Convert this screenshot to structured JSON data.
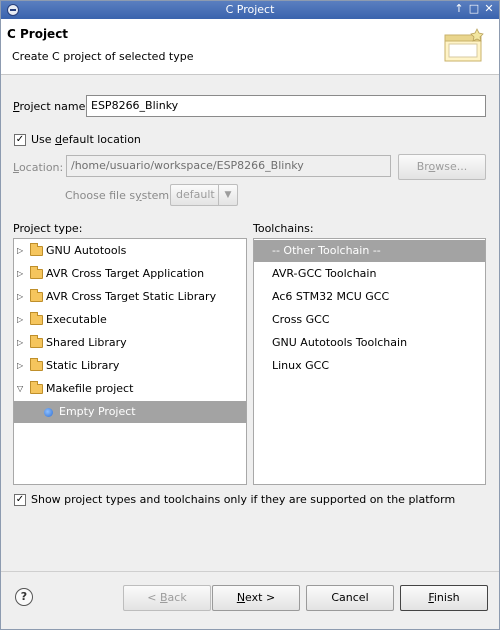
{
  "window": {
    "title": "C Project"
  },
  "header": {
    "title": "C Project",
    "subtitle": "Create C project of selected type"
  },
  "project_name": {
    "label_pre": "P",
    "label_rest": "roject name:",
    "value": "ESP8266_Blinky"
  },
  "use_default": {
    "label_pre": "Use ",
    "label_u": "d",
    "label_rest": "efault location",
    "checked_glyph": "✓"
  },
  "location": {
    "label_u": "L",
    "label_rest": "ocation:",
    "value": "/home/usuario/workspace/ESP8266_Blinky",
    "browse_pre": "Br",
    "browse_u": "o",
    "browse_rest": "wse..."
  },
  "file_system": {
    "label_pre": "Choose file s",
    "label_u": "y",
    "label_rest": "stem:",
    "value": "default"
  },
  "project_type": {
    "label": "Project type:",
    "items": [
      {
        "label": "GNU Autotools",
        "expanded": false
      },
      {
        "label": "AVR Cross Target Application",
        "expanded": false
      },
      {
        "label": "AVR Cross Target Static Library",
        "expanded": false
      },
      {
        "label": "Executable",
        "expanded": false
      },
      {
        "label": "Shared Library",
        "expanded": false
      },
      {
        "label": "Static Library",
        "expanded": false
      },
      {
        "label": "Makefile project",
        "expanded": true
      }
    ],
    "child": "Empty Project"
  },
  "toolchains": {
    "label": "Toolchains:",
    "items": [
      "-- Other Toolchain --",
      "AVR-GCC Toolchain",
      "Ac6 STM32 MCU GCC",
      "Cross GCC",
      "GNU Autotools Toolchain",
      "Linux GCC"
    ]
  },
  "show_supported": {
    "label": "Show project types and toolchains only if they are supported on the platform"
  },
  "buttons": {
    "back": {
      "pre": "< ",
      "u": "B",
      "rest": "ack"
    },
    "next": {
      "u": "N",
      "rest": "ext >"
    },
    "cancel": "Cancel",
    "finish": {
      "u": "F",
      "rest": "inish"
    }
  },
  "titlebar_controls": {
    "up": "↑",
    "minimize": "□",
    "close": "✕"
  },
  "help_glyph": "?"
}
